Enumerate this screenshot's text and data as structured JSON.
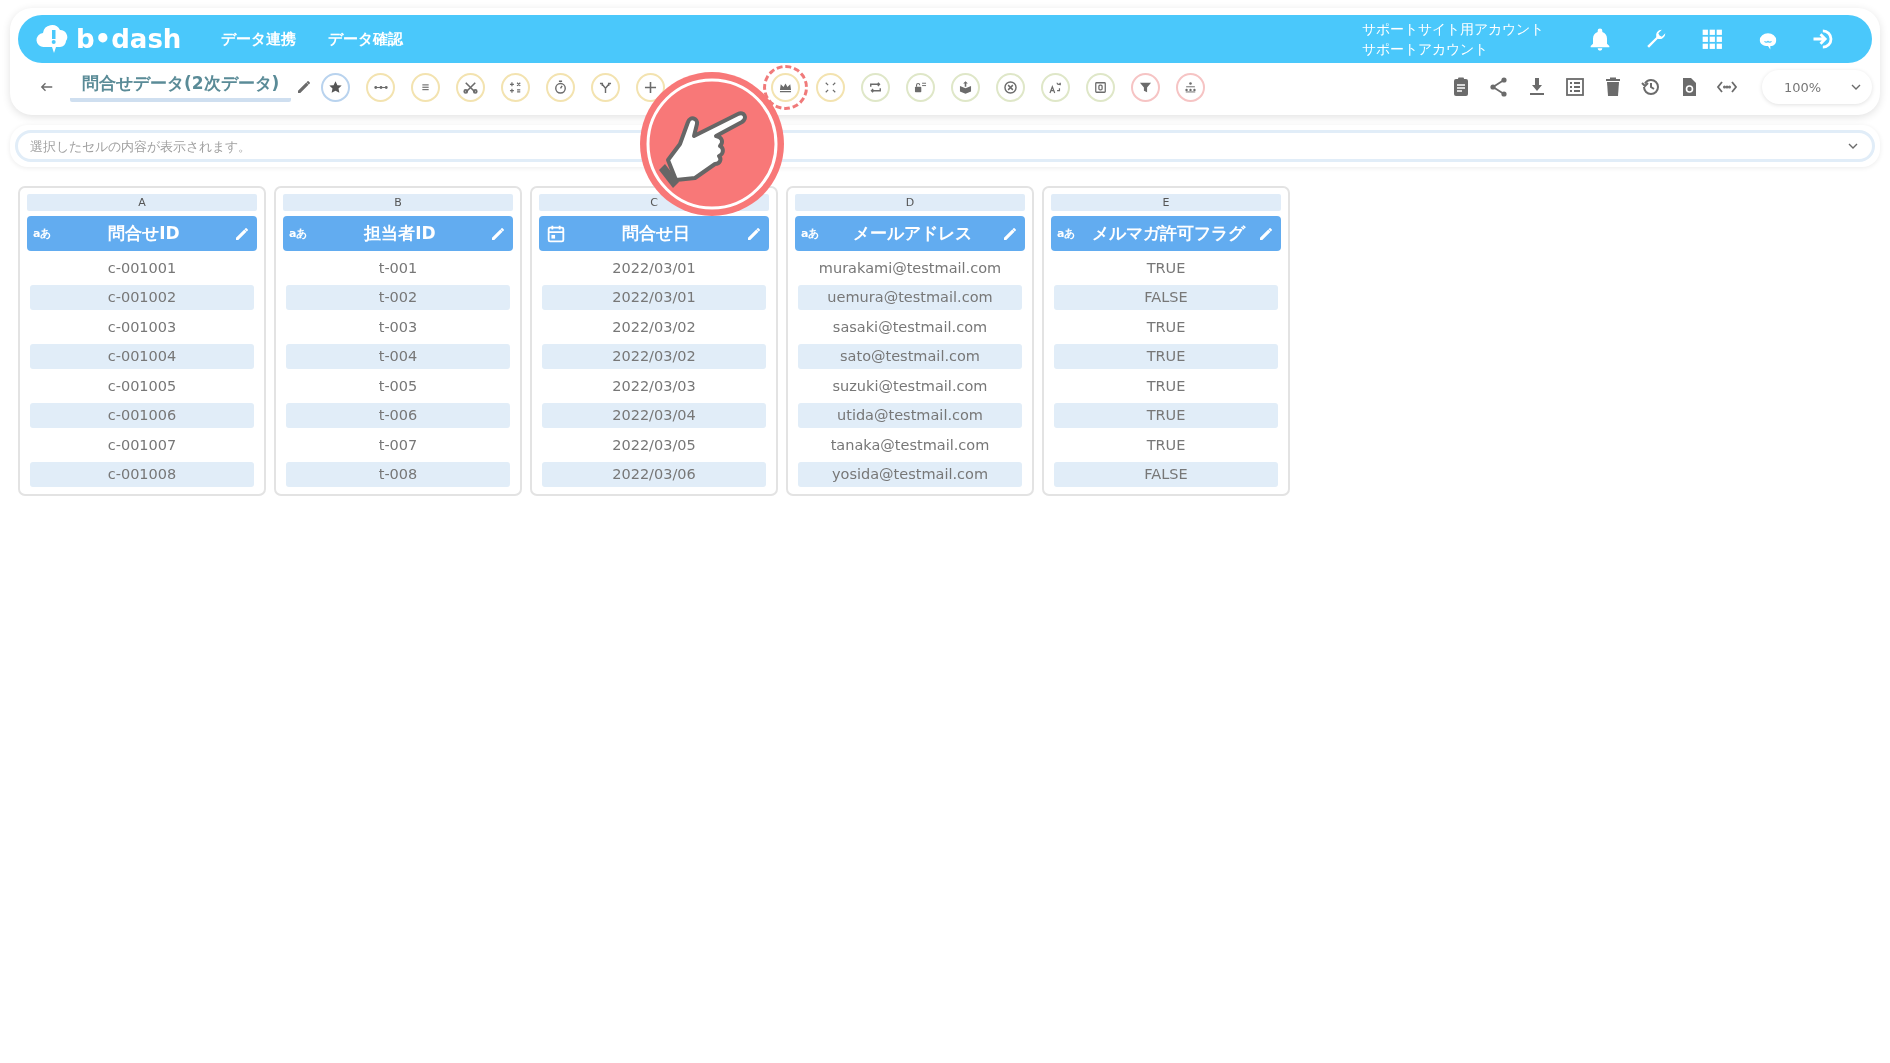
{
  "header": {
    "logo": "b•dash",
    "nav": [
      {
        "label": "データ連携"
      },
      {
        "label": "データ確認"
      }
    ],
    "account": {
      "site": "サポートサイト用アカウント",
      "user": "サポートアカウント"
    },
    "icons": [
      {
        "kind": "bell"
      },
      {
        "kind": "wrench"
      },
      {
        "kind": "grid"
      },
      {
        "kind": "mascot"
      },
      {
        "kind": "logout"
      }
    ]
  },
  "toolbar": {
    "title": "問合せデータ(2次データ)",
    "tools": [
      {
        "kind": "star",
        "color": "#b9d3ee",
        "highlighted": false
      },
      {
        "kind": "dots",
        "color": "#f3e3b0",
        "highlighted": false
      },
      {
        "kind": "lines",
        "color": "#f3e3b0",
        "highlighted": false
      },
      {
        "kind": "scissors",
        "color": "#f3e3b0",
        "highlighted": false
      },
      {
        "kind": "math",
        "color": "#f3e3b0",
        "highlighted": false
      },
      {
        "kind": "stopwatch",
        "color": "#f3e3b0",
        "highlighted": false
      },
      {
        "kind": "fork",
        "color": "#f3e3b0",
        "highlighted": false
      },
      {
        "kind": "plus",
        "color": "#f3e3b0",
        "highlighted": false
      },
      {
        "kind": "covered"
      },
      {
        "kind": "covered"
      },
      {
        "kind": "crown",
        "color": "#f3e3b0",
        "highlighted": true
      },
      {
        "kind": "compress",
        "color": "#f3e3b0",
        "highlighted": false
      },
      {
        "kind": "repeat",
        "color": "#dfe7c8",
        "highlighted": false
      },
      {
        "kind": "lock",
        "color": "#dfe7c8",
        "highlighted": false
      },
      {
        "kind": "box",
        "color": "#dfe7c8",
        "highlighted": false
      },
      {
        "kind": "xcircle",
        "color": "#dfe7c8",
        "highlighted": false
      },
      {
        "kind": "translate",
        "color": "#dfe7c8",
        "highlighted": false
      },
      {
        "kind": "zero",
        "color": "#dfe7c8",
        "highlighted": false
      },
      {
        "kind": "filter",
        "color": "#f6c4c4",
        "highlighted": false
      },
      {
        "kind": "hierarchy",
        "color": "#f6c4c4",
        "highlighted": false
      }
    ],
    "actions": [
      {
        "kind": "clipboard"
      },
      {
        "kind": "share"
      },
      {
        "kind": "download"
      },
      {
        "kind": "list"
      },
      {
        "kind": "trash"
      },
      {
        "kind": "history"
      },
      {
        "kind": "file-refresh"
      },
      {
        "kind": "code"
      }
    ],
    "zoom": "100%"
  },
  "formula_bar": {
    "placeholder": "選択したセルの内容が表示されます。"
  },
  "table": {
    "columns": [
      {
        "letter": "A",
        "name": "問合せID",
        "kind": "text",
        "type_label": "aあ",
        "cells": [
          "c-001001",
          "c-001002",
          "c-001003",
          "c-001004",
          "c-001005",
          "c-001006",
          "c-001007",
          "c-001008"
        ]
      },
      {
        "letter": "B",
        "name": "担当者ID",
        "kind": "text",
        "type_label": "aあ",
        "cells": [
          "t-001",
          "t-002",
          "t-003",
          "t-004",
          "t-005",
          "t-006",
          "t-007",
          "t-008"
        ]
      },
      {
        "letter": "C",
        "name": "問合せ日",
        "kind": "date",
        "cells": [
          "2022/03/01",
          "2022/03/01",
          "2022/03/02",
          "2022/03/02",
          "2022/03/03",
          "2022/03/04",
          "2022/03/05",
          "2022/03/06"
        ]
      },
      {
        "letter": "D",
        "name": "メールアドレス",
        "kind": "text",
        "type_label": "aあ",
        "cells": [
          "murakami@testmail.com",
          "uemura@testmail.com",
          "sasaki@testmail.com",
          "sato@testmail.com",
          "suzuki@testmail.com",
          "utida@testmail.com",
          "tanaka@testmail.com",
          "yosida@testmail.com"
        ]
      },
      {
        "letter": "E",
        "name": "メルマガ許可フラグ",
        "kind": "text",
        "type_label": "aあ",
        "cells": [
          "TRUE",
          "FALSE",
          "TRUE",
          "TRUE",
          "TRUE",
          "TRUE",
          "TRUE",
          "FALSE"
        ]
      }
    ]
  }
}
